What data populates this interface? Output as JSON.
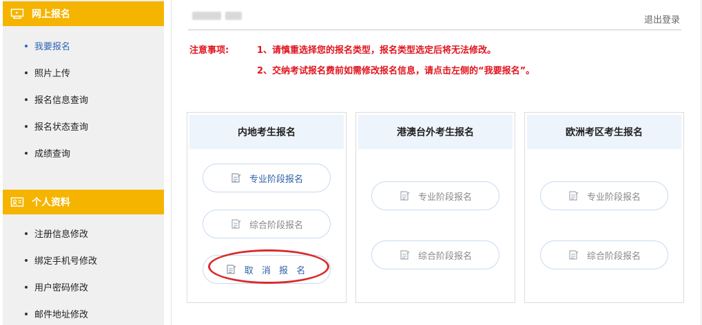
{
  "sidebar": {
    "section1": {
      "title": "网上报名",
      "icon": "monitor-icon"
    },
    "items1": [
      {
        "label": "我要报名",
        "active": true
      },
      {
        "label": "照片上传"
      },
      {
        "label": "报名信息查询"
      },
      {
        "label": "报名状态查询"
      },
      {
        "label": "成绩查询"
      }
    ],
    "section2": {
      "title": "个人资料",
      "icon": "id-card-icon"
    },
    "items2": [
      {
        "label": "注册信息修改"
      },
      {
        "label": "绑定手机号修改"
      },
      {
        "label": "用户密码修改"
      },
      {
        "label": "邮件地址修改"
      }
    ]
  },
  "header": {
    "logout": "退出登录"
  },
  "notice": {
    "label": "注意事项:",
    "line1": "1、请慎重选择您的报名类型，报名类型选定后将无法修改。",
    "line2": "2、交纳考试报名费前如需修改报名信息，请点击左侧的“我要报名”。"
  },
  "cards": [
    {
      "title": "内地考生报名",
      "buttons": [
        "专业阶段报名",
        "综合阶段报名",
        "取 消 报 名"
      ]
    },
    {
      "title": "港澳台外考生报名",
      "buttons": [
        "专业阶段报名",
        "综合阶段报名"
      ]
    },
    {
      "title": "欧洲考区考生报名",
      "buttons": [
        "专业阶段报名",
        "综合阶段报名"
      ]
    }
  ],
  "colors": {
    "sidebar_header": "#f5b400",
    "notice_red": "#e0141e",
    "active_blue": "#2e63b8",
    "card_head_bg": "#edf4fc",
    "highlight_ellipse": "#d92b2b"
  }
}
